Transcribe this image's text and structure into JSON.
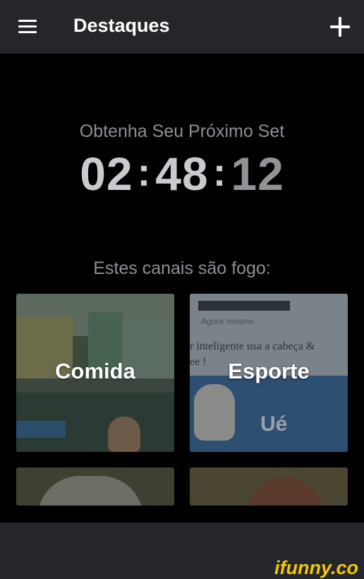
{
  "header": {
    "title": "Destaques",
    "menu_icon": "hamburger-icon",
    "add_icon": "plus-icon"
  },
  "countdown": {
    "subtitle": "Obtenha Seu Próximo Set",
    "hours": "02",
    "minutes": "48",
    "seconds": "12",
    "separator": ":"
  },
  "channels": {
    "heading": "Estes canais são fogo:",
    "cards": [
      {
        "label": "Comida"
      },
      {
        "label": "Esporte",
        "image_texts": [
          "Agora mesmo",
          "r inteligente usa a cabeça &",
          "ee !",
          "Ué"
        ]
      }
    ]
  },
  "watermark": "ifunny.co",
  "colors": {
    "header_bg": "#24262a",
    "page_bg": "#000000",
    "muted_text": "#8c8f94",
    "watermark": "#f2c800"
  }
}
